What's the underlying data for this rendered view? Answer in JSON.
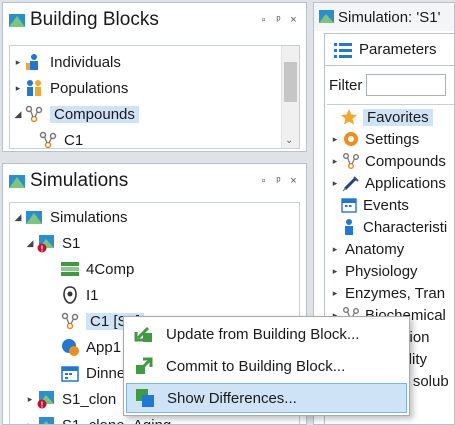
{
  "building_blocks": {
    "title": "Building Blocks",
    "items": [
      {
        "label": "Individuals"
      },
      {
        "label": "Populations"
      },
      {
        "label": "Compounds"
      },
      {
        "label": "C1"
      }
    ]
  },
  "simulations": {
    "title": "Simulations",
    "root": "Simulations",
    "s1": "S1",
    "children": [
      "4Comp",
      "I1",
      "C1 [S1]",
      "App1",
      "Dinne"
    ],
    "s1_clone": "S1_clon",
    "s1_clone_aging": "S1_clone_Aging"
  },
  "simulation_panel": {
    "title": "Simulation: 'S1'",
    "tab": "Parameters",
    "filter_label": "Filter",
    "tree": [
      "Favorites",
      "Settings",
      "Compounds",
      "Applications",
      "Events",
      "Characteristi",
      "Anatomy",
      "Physiology",
      "Enzymes, Tran",
      "Biochemical",
      "ation",
      "bility",
      "al solub"
    ]
  },
  "context_menu": {
    "items": [
      {
        "label": "Update from Building Block..."
      },
      {
        "label": "Commit to Building Block..."
      },
      {
        "label": "Show Differences..."
      }
    ]
  },
  "header_buttons": {
    "restore": "▫",
    "pin": "ᵖ",
    "close": "×"
  },
  "colors": {
    "selection": "#cfe3f6",
    "accent_blue": "#1e78d4",
    "green": "#3f9b3f",
    "orange": "#f28c1a"
  }
}
